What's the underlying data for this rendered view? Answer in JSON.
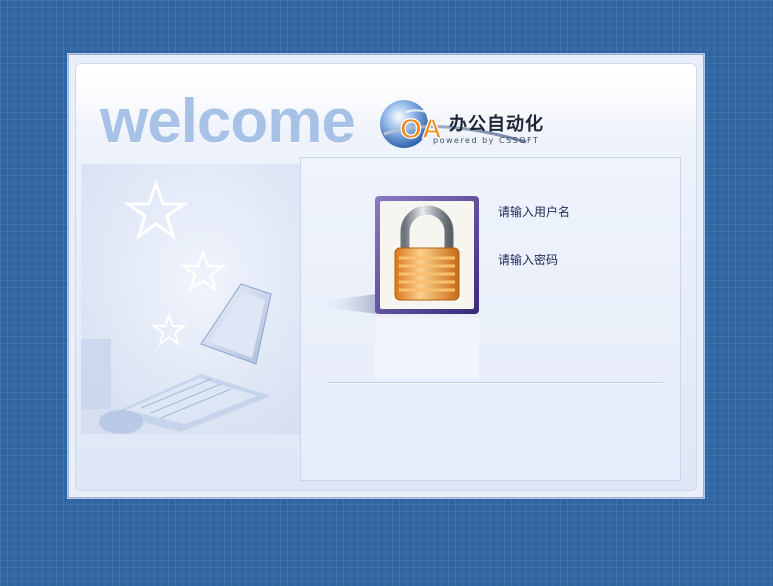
{
  "header": {
    "welcome": "welcome",
    "product": "办公自动化",
    "logo_mark": "OA",
    "powered_by": "powered by CSSOFT"
  },
  "form": {
    "username_label": "请输入用户名",
    "password_label": "请输入密码"
  },
  "icons": {
    "lock": "padlock-icon",
    "logo": "oa-globe-logo",
    "illustration": "computer-stars-illustration"
  },
  "colors": {
    "background": "#2f65a0",
    "panel": "#e9eef9",
    "welcome_text": "#a8c1e6",
    "accent_orange": "#f08a1c"
  }
}
